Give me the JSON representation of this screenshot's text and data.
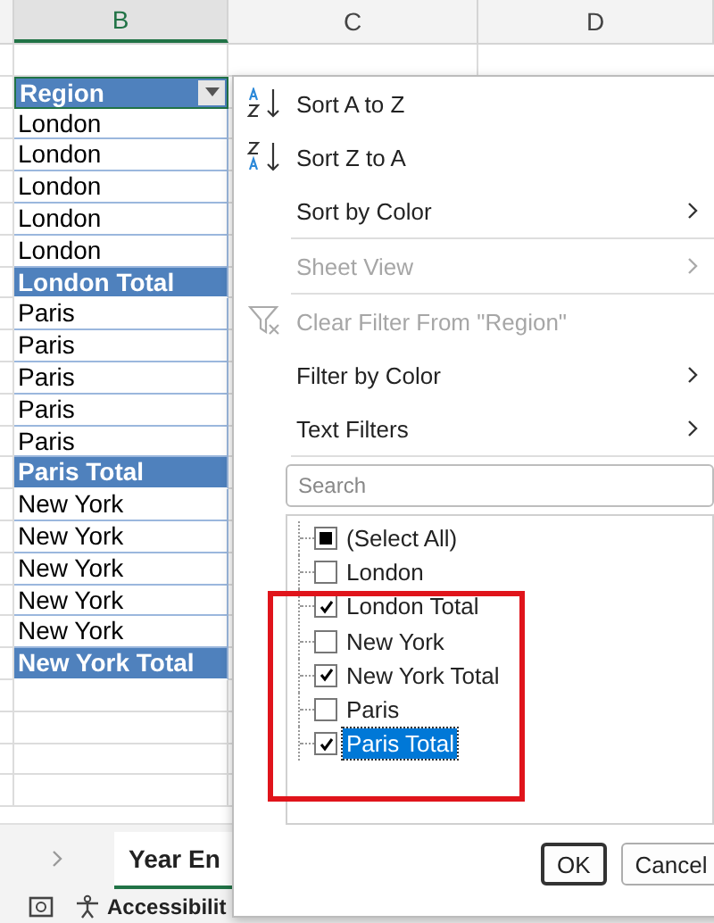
{
  "columns": [
    {
      "label": "B",
      "selected": true
    },
    {
      "label": "C",
      "selected": false
    },
    {
      "label": "D",
      "selected": false
    }
  ],
  "table": {
    "header": "Region",
    "rows": [
      {
        "text": "London",
        "kind": "item"
      },
      {
        "text": "London",
        "kind": "item"
      },
      {
        "text": "London",
        "kind": "item"
      },
      {
        "text": "London",
        "kind": "item"
      },
      {
        "text": "London",
        "kind": "item"
      },
      {
        "text": "London Total",
        "kind": "total"
      },
      {
        "text": "Paris",
        "kind": "item"
      },
      {
        "text": "Paris",
        "kind": "item"
      },
      {
        "text": "Paris",
        "kind": "item"
      },
      {
        "text": "Paris",
        "kind": "item"
      },
      {
        "text": "Paris",
        "kind": "item"
      },
      {
        "text": "Paris Total",
        "kind": "total"
      },
      {
        "text": "New York",
        "kind": "item"
      },
      {
        "text": "New York",
        "kind": "item"
      },
      {
        "text": "New York",
        "kind": "item"
      },
      {
        "text": "New York",
        "kind": "item"
      },
      {
        "text": "New York",
        "kind": "item"
      },
      {
        "text": "New York Total",
        "kind": "total"
      }
    ]
  },
  "menu": {
    "items": [
      {
        "kind": "sort-ascending",
        "label": "Sort A to Z",
        "disabled": false,
        "submenu": false
      },
      {
        "kind": "sort-descending",
        "label": "Sort Z to A",
        "disabled": false,
        "submenu": false
      },
      {
        "kind": "command",
        "label": "Sort by Color",
        "disabled": false,
        "submenu": true
      },
      {
        "kind": "separator"
      },
      {
        "kind": "command",
        "label": "Sheet View",
        "disabled": true,
        "submenu": true
      },
      {
        "kind": "separator"
      },
      {
        "kind": "clear-filter",
        "label": "Clear Filter From \"Region\"",
        "disabled": true,
        "submenu": false
      },
      {
        "kind": "command",
        "label": "Filter by Color",
        "disabled": false,
        "submenu": true
      },
      {
        "kind": "command",
        "label": "Text Filters",
        "disabled": false,
        "submenu": true
      },
      {
        "kind": "separator"
      }
    ]
  },
  "search": {
    "placeholder": "Search"
  },
  "filter_list": [
    {
      "label": "(Select All)",
      "checked": false,
      "indeterminate": true,
      "selected": false
    },
    {
      "label": "London",
      "checked": false,
      "indeterminate": false,
      "selected": false
    },
    {
      "label": "London Total",
      "checked": true,
      "indeterminate": false,
      "selected": false
    },
    {
      "label": "New York",
      "checked": false,
      "indeterminate": false,
      "selected": false
    },
    {
      "label": "New York Total",
      "checked": true,
      "indeterminate": false,
      "selected": false
    },
    {
      "label": "Paris",
      "checked": false,
      "indeterminate": false,
      "selected": false
    },
    {
      "label": "Paris Total",
      "checked": true,
      "indeterminate": false,
      "selected": true
    }
  ],
  "buttons": [
    {
      "label": "OK",
      "default": true
    },
    {
      "label": "Cancel",
      "default": false
    }
  ],
  "sheet_tabs": [
    {
      "label": "Year En",
      "selected": true
    }
  ],
  "status_bar": {
    "text": "Accessibilit"
  }
}
